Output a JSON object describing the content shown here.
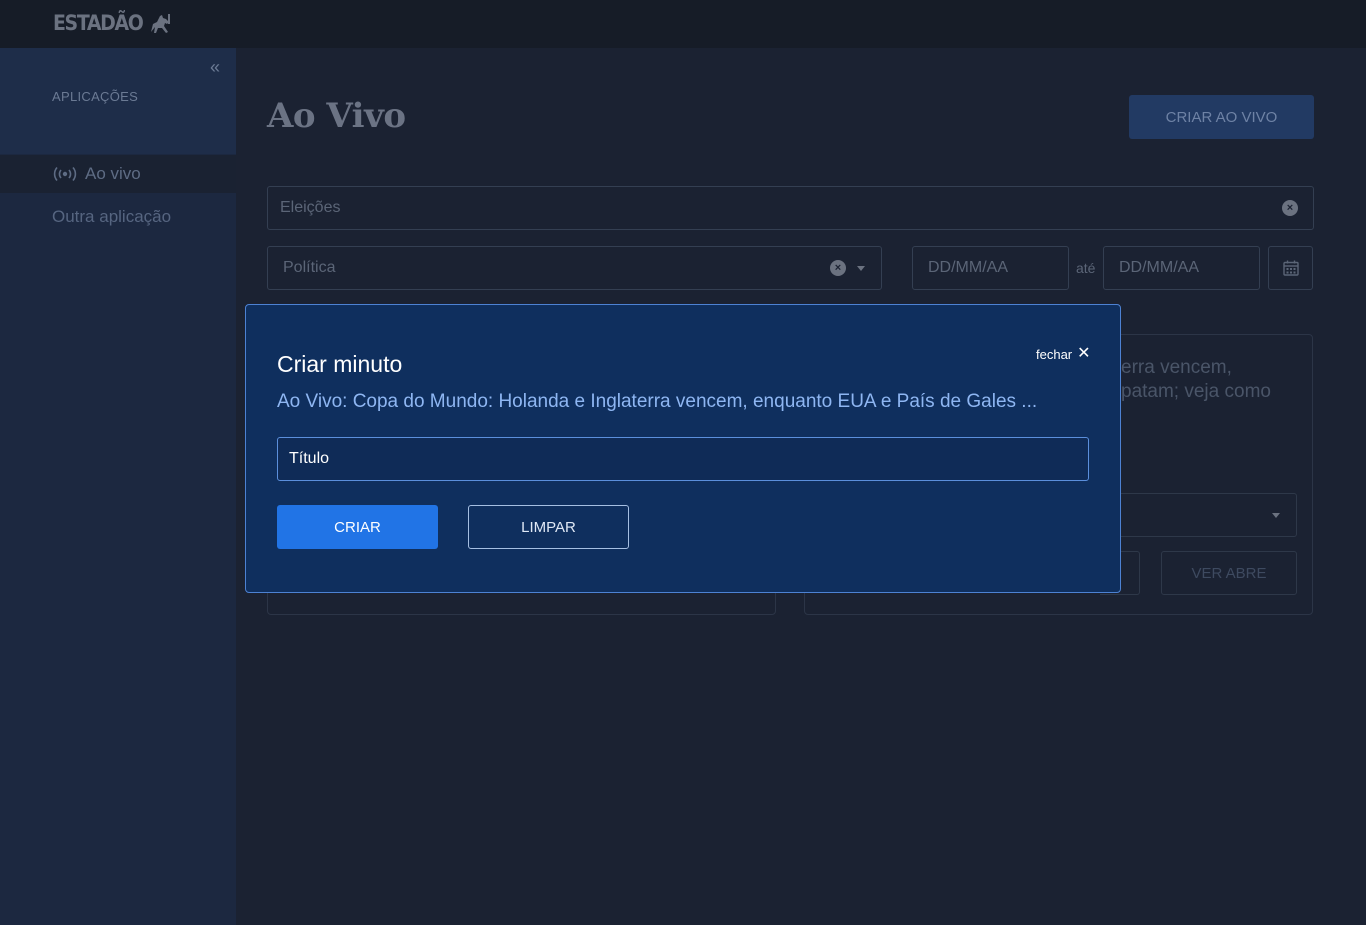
{
  "brand": {
    "name": "ESTADÃO"
  },
  "sidebar": {
    "section_title": "APLICAÇÕES",
    "items": [
      {
        "label": "Ao vivo",
        "icon": "broadcast-icon",
        "active": true
      },
      {
        "label": "Outra aplicação",
        "active": false
      }
    ]
  },
  "main": {
    "title": "Ao Vivo",
    "create_button": "CRIAR AO VIVO",
    "filters": {
      "search_placeholder": "Eleições",
      "category_value": "Política",
      "date_from_placeholder": "DD/MM/AA",
      "date_separator": "até",
      "date_to_placeholder": "DD/MM/AA"
    },
    "card": {
      "text_line1": "erra vencem,",
      "text_line2": "patam; veja como",
      "button": "VER ABRE"
    }
  },
  "modal": {
    "title": "Criar minuto",
    "close_label": "fechar",
    "subtitle": "Ao Vivo: Copa do Mundo: Holanda e Inglaterra vencem, enquanto EUA e País de Gales ...",
    "input_placeholder": "Título",
    "primary_button": "CRIAR",
    "secondary_button": "LIMPAR"
  },
  "colors": {
    "accent": "#2174e6",
    "modal_bg": "#0f2f5e",
    "page_bg": "#1b2232"
  }
}
